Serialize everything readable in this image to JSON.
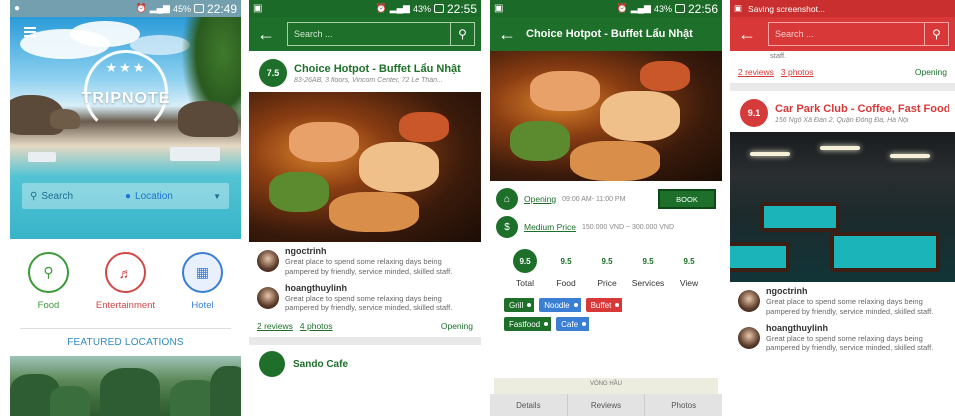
{
  "screen1": {
    "status_time": "22:49",
    "status_battery": "45%",
    "logo_stars": "★★★",
    "logo_text": "TRIPNOTE",
    "search_placeholder": "Search",
    "location_label": "Location",
    "categories": [
      {
        "label": "Food",
        "icon": "fork-knife-icon",
        "glyph": "⚲"
      },
      {
        "label": "Entertainment",
        "icon": "guitar-icon",
        "glyph": "♬"
      },
      {
        "label": "Hotel",
        "icon": "hotel-icon",
        "glyph": "▦"
      }
    ],
    "featured_title": "FEATURED LOCATIONS"
  },
  "screen2": {
    "status_time": "22:55",
    "status_battery": "43%",
    "search_placeholder": "Search ...",
    "place": {
      "score": "7.5",
      "name": "Choice Hotpot - Buffet Lẩu Nhật",
      "address": "83-26AB, 3 floors, Vincom Center, 72 Le Thán..."
    },
    "reviews": [
      {
        "name": "ngoctrinh",
        "text": "Great place to spend some relaxing days being pampered by friendly, service minded, skilled staff."
      },
      {
        "name": "hoangthuylinh",
        "text": "Great place to spend some relaxing days being pampered by friendly, service minded, skilled staff."
      }
    ],
    "reviews_link": "2 reviews",
    "photos_link": "4 photos",
    "status_open": "Opening",
    "next_place_name": "Sando Cafe"
  },
  "screen3": {
    "status_time": "22:56",
    "status_battery": "43%",
    "title": "Choice Hotpot - Buffet Lẩu Nhật",
    "opening_label": "Opening",
    "opening_hours": "09:00 AM- 11:00 PM",
    "book_label": "BOOK",
    "price_label": "Medium Price",
    "price_range": "150.000 VND ~ 300.000 VND",
    "scores": [
      {
        "value": "9.5",
        "name": "Total"
      },
      {
        "value": "9.5",
        "name": "Food"
      },
      {
        "value": "9.5",
        "name": "Price"
      },
      {
        "value": "9.5",
        "name": "Services"
      },
      {
        "value": "9.5",
        "name": "View"
      }
    ],
    "tags": [
      {
        "label": "Grill",
        "color": "#1d6f2a"
      },
      {
        "label": "Noodle",
        "color": "#3a7fd4"
      },
      {
        "label": "Buffet",
        "color": "#d93838"
      },
      {
        "label": "Fastfood",
        "color": "#1d6f2a"
      },
      {
        "label": "Cafe",
        "color": "#3a7fd4"
      }
    ],
    "map_text": "VÒNG HẦU",
    "tabs": [
      "Details",
      "Reviews",
      "Photos"
    ]
  },
  "screen4": {
    "status_text": "Saving screenshot...",
    "search_placeholder": "Search ...",
    "cut_text": "staff.",
    "reviews_link": "2 reviews",
    "photos_link": "3 photos",
    "status_open": "Opening",
    "place": {
      "score": "9.1",
      "name": "Car Park Club - Coffee, Fast Food &",
      "address": "156 Ngô Xã Đàn 2, Quận Đống Đa, Hà Nội"
    },
    "reviews": [
      {
        "name": "ngoctrinh",
        "text": "Great place to spend some relaxing days being pampered by friendly, service minded, skilled staff."
      },
      {
        "name": "hoangthuylinh",
        "text": "Great place to spend some relaxing days being pampered by friendly, service minded, skilled staff."
      }
    ]
  },
  "colors": {
    "green": "#1d6f2a",
    "red": "#d93838",
    "blue": "#3a7fd4"
  }
}
